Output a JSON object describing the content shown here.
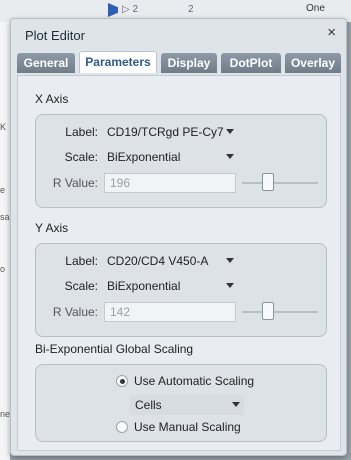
{
  "background": {
    "top_texts": [
      "▷ 2",
      "2",
      "One"
    ],
    "left_texts": [
      "K",
      "e",
      "sa",
      "o",
      "ne"
    ]
  },
  "dialog": {
    "title": "Plot Editor",
    "close_glyph": "×"
  },
  "tabs": [
    {
      "label": "General",
      "active": false
    },
    {
      "label": "Parameters",
      "active": true
    },
    {
      "label": "Display",
      "active": false
    },
    {
      "label": "DotPlot",
      "active": false
    },
    {
      "label": "Overlay",
      "active": false
    }
  ],
  "x_axis": {
    "heading": "X Axis",
    "label_caption": "Label:",
    "label_value": "CD19/TCRgd PE-Cy7",
    "scale_caption": "Scale:",
    "scale_value": "BiExponential",
    "r_caption": "R Value:",
    "r_value": "196"
  },
  "y_axis": {
    "heading": "Y Axis",
    "label_caption": "Label:",
    "label_value": "CD20/CD4 V450-A",
    "scale_caption": "Scale:",
    "scale_value": "BiExponential",
    "r_caption": "R Value:",
    "r_value": "142"
  },
  "global_scaling": {
    "heading": "Bi-Exponential Global Scaling",
    "auto_label": "Use Automatic Scaling",
    "auto_selected": true,
    "dropdown_value": "Cells",
    "manual_label": "Use Manual Scaling",
    "manual_selected": false
  },
  "colors": {
    "active_tab_text": "#2e5a88",
    "tab_bg": "#7b8795",
    "panel_bg": "#e9edf1"
  },
  "icons": {
    "close": "close-icon",
    "dropdown": "chevron-down-icon"
  }
}
